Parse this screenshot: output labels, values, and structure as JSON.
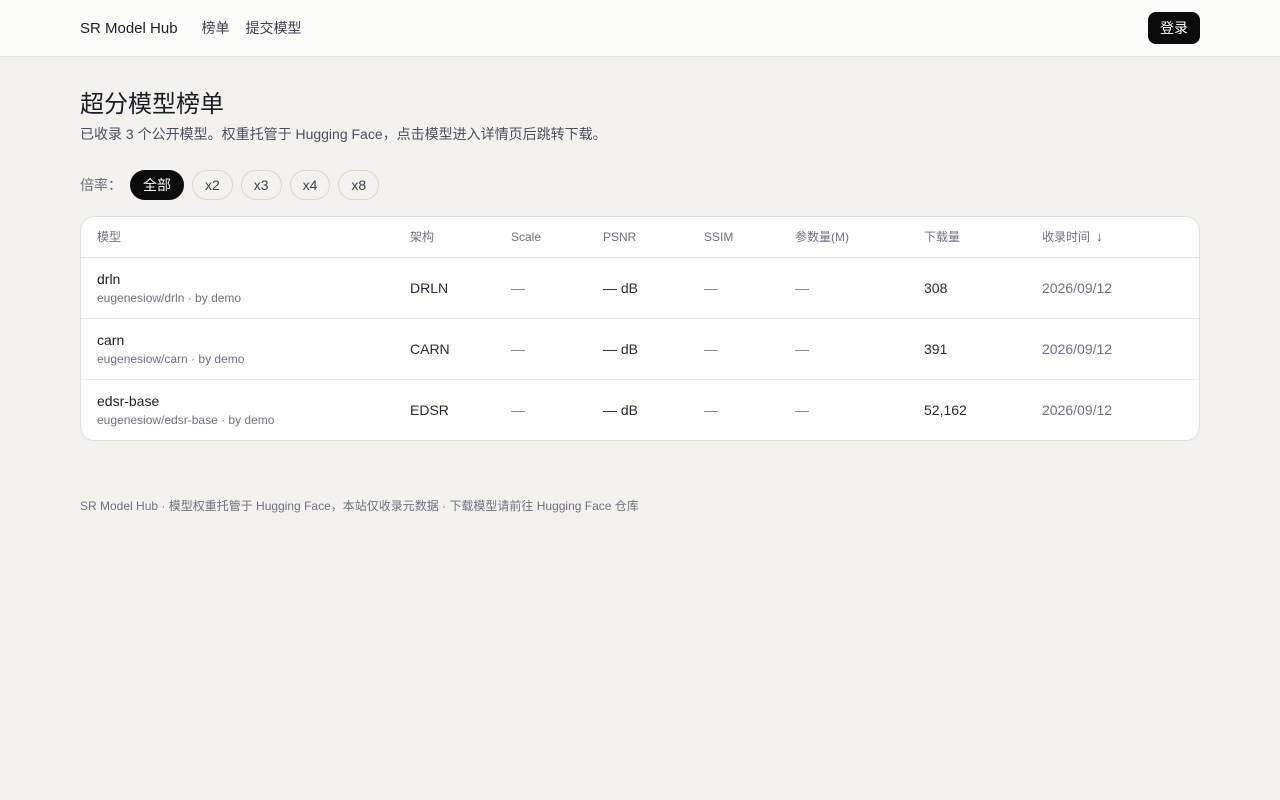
{
  "header": {
    "brand": "SR Model Hub",
    "nav": [
      "榜单",
      "提交模型"
    ],
    "login": "登录"
  },
  "page": {
    "title": "超分模型榜单",
    "description": "已收录 3 个公开模型。权重托管于 Hugging Face，点击模型进入详情页后跳转下载。"
  },
  "filter": {
    "label": "倍率：",
    "options": [
      "全部",
      "x2",
      "x3",
      "x4",
      "x8"
    ],
    "selected": "全部"
  },
  "table": {
    "columns": [
      "模型",
      "架构",
      "Scale",
      "PSNR",
      "SSIM",
      "参数量(M)",
      "下载量",
      "收录时间"
    ],
    "sort_icon": "↓",
    "rows": [
      {
        "name": "drln",
        "repo": "eugenesiow/drln · by demo",
        "arch": "DRLN",
        "scale": "—",
        "psnr": "— dB",
        "ssim": "—",
        "params": "—",
        "downloads": "308",
        "date": "2026/09/12"
      },
      {
        "name": "carn",
        "repo": "eugenesiow/carn · by demo",
        "arch": "CARN",
        "scale": "—",
        "psnr": "— dB",
        "ssim": "—",
        "params": "—",
        "downloads": "391",
        "date": "2026/09/12"
      },
      {
        "name": "edsr-base",
        "repo": "eugenesiow/edsr-base · by demo",
        "arch": "EDSR",
        "scale": "—",
        "psnr": "— dB",
        "ssim": "—",
        "params": "—",
        "downloads": "52,162",
        "date": "2026/09/12"
      }
    ]
  },
  "footer": {
    "text": "SR Model Hub · 模型权重托管于 Hugging Face，本站仅收录元数据 · 下载模型请前往 Hugging Face 仓库"
  }
}
